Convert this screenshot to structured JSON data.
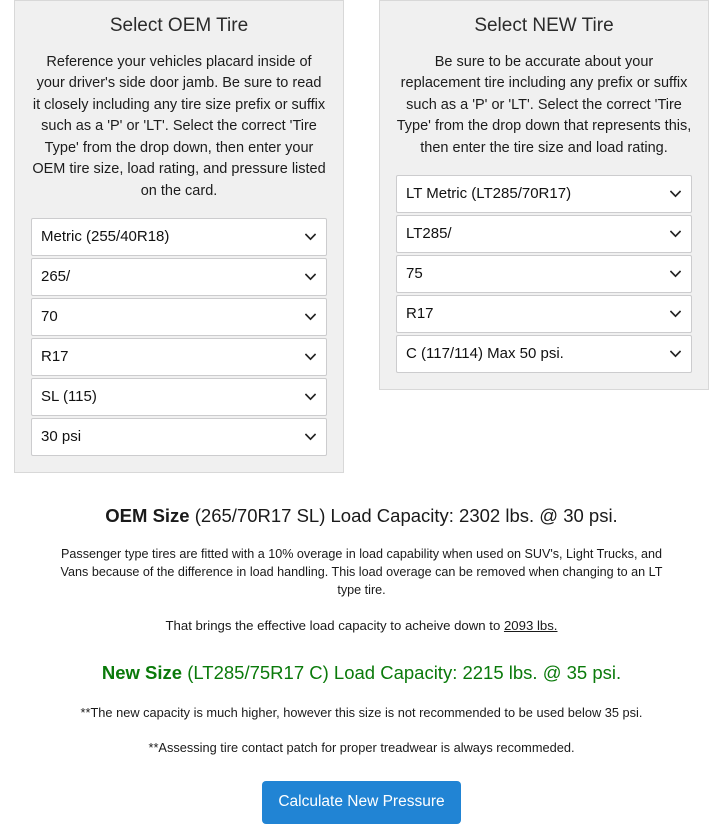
{
  "panels": {
    "oem": {
      "title": "Select OEM Tire",
      "description": "Reference your vehicles placard inside of your driver's side door jamb. Be sure to read it closely including any tire size prefix or suffix such as a 'P' or 'LT'. Select the correct 'Tire Type' from the drop down, then enter your OEM tire size, load rating, and pressure listed on the card.",
      "selects": [
        {
          "name": "tire-type",
          "value": "Metric (255/40R18)"
        },
        {
          "name": "section-width",
          "value": "265/"
        },
        {
          "name": "aspect-ratio",
          "value": "70"
        },
        {
          "name": "rim-diameter",
          "value": "R17"
        },
        {
          "name": "load-rating",
          "value": "SL (115)"
        },
        {
          "name": "pressure",
          "value": "30 psi"
        }
      ]
    },
    "new": {
      "title": "Select NEW Tire",
      "description": "Be sure to be accurate about your replacement tire including any prefix or suffix such as a 'P' or 'LT'. Select the correct 'Tire Type' from the drop down that represents this, then enter the tire size and load rating.",
      "selects": [
        {
          "name": "tire-type",
          "value": "LT Metric (LT285/70R17)"
        },
        {
          "name": "section-width",
          "value": "LT285/"
        },
        {
          "name": "aspect-ratio",
          "value": "75"
        },
        {
          "name": "rim-diameter",
          "value": "R17"
        },
        {
          "name": "load-rating",
          "value": "C (117/114) Max 50 psi."
        }
      ]
    }
  },
  "results": {
    "oem": {
      "label": "OEM Size",
      "detail": " (265/70R17 SL) Load Capacity: 2302 lbs. @ 30 psi.",
      "size": "265/70R17 SL",
      "load_capacity_lbs": 2302,
      "pressure_psi": 30
    },
    "overage_note": "Passenger type tires are fitted with a 10% overage in load capability when used on SUV's, Light Trucks, and Vans because of the difference in load handling. This load overage can be removed when changing to an LT type tire.",
    "effective": {
      "prefix": "That brings the effective load capacity to acheive down to ",
      "value": "2093 lbs.",
      "value_lbs": 2093
    },
    "new": {
      "label": "New Size",
      "detail": " (LT285/75R17 C) Load Capacity: 2215 lbs. @ 35 psi.",
      "size": "LT285/75R17 C",
      "load_capacity_lbs": 2215,
      "pressure_psi": 35
    },
    "note_one": "**The new capacity is much higher, however this size is not recommended to be used below 35 psi.",
    "note_two": "**Assessing tire contact patch for proper treadwear is always recommeded."
  },
  "actions": {
    "calculate_label": "Calculate New Pressure"
  },
  "colors": {
    "panel_bg": "#f0f0f0",
    "panel_border": "#d8d8d8",
    "button_blue": "#2184d4",
    "new_size_green": "#0a7a0a",
    "text": "#1a1a1a"
  }
}
